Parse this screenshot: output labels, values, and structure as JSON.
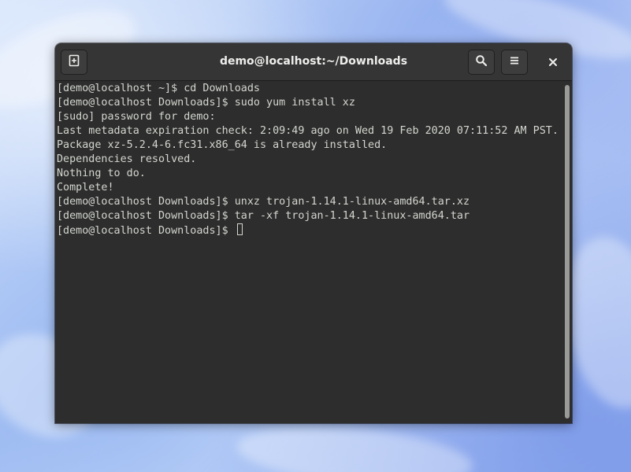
{
  "window": {
    "title": "demo@localhost:~/Downloads"
  },
  "headerbar": {
    "new_tab_icon": "new-tab-plus-icon",
    "search_icon": "magnifier-icon",
    "menu_icon": "hamburger-menu-icon",
    "close_icon": "close-x-icon"
  },
  "terminal": {
    "lines": [
      "[demo@localhost ~]$ cd Downloads",
      "[demo@localhost Downloads]$ sudo yum install xz",
      "[sudo] password for demo:",
      "Last metadata expiration check: 2:09:49 ago on Wed 19 Feb 2020 07:11:52 AM PST.",
      "Package xz-5.2.4-6.fc31.x86_64 is already installed.",
      "Dependencies resolved.",
      "Nothing to do.",
      "Complete!",
      "[demo@localhost Downloads]$ unxz trojan-1.14.1-linux-amd64.tar.xz",
      "[demo@localhost Downloads]$ tar -xf trojan-1.14.1-linux-amd64.tar",
      "[demo@localhost Downloads]$ "
    ]
  },
  "colors": {
    "terminal_bg": "#2d2d2d",
    "terminal_fg": "#d3d7cf",
    "headerbar_bg": "#353535"
  }
}
